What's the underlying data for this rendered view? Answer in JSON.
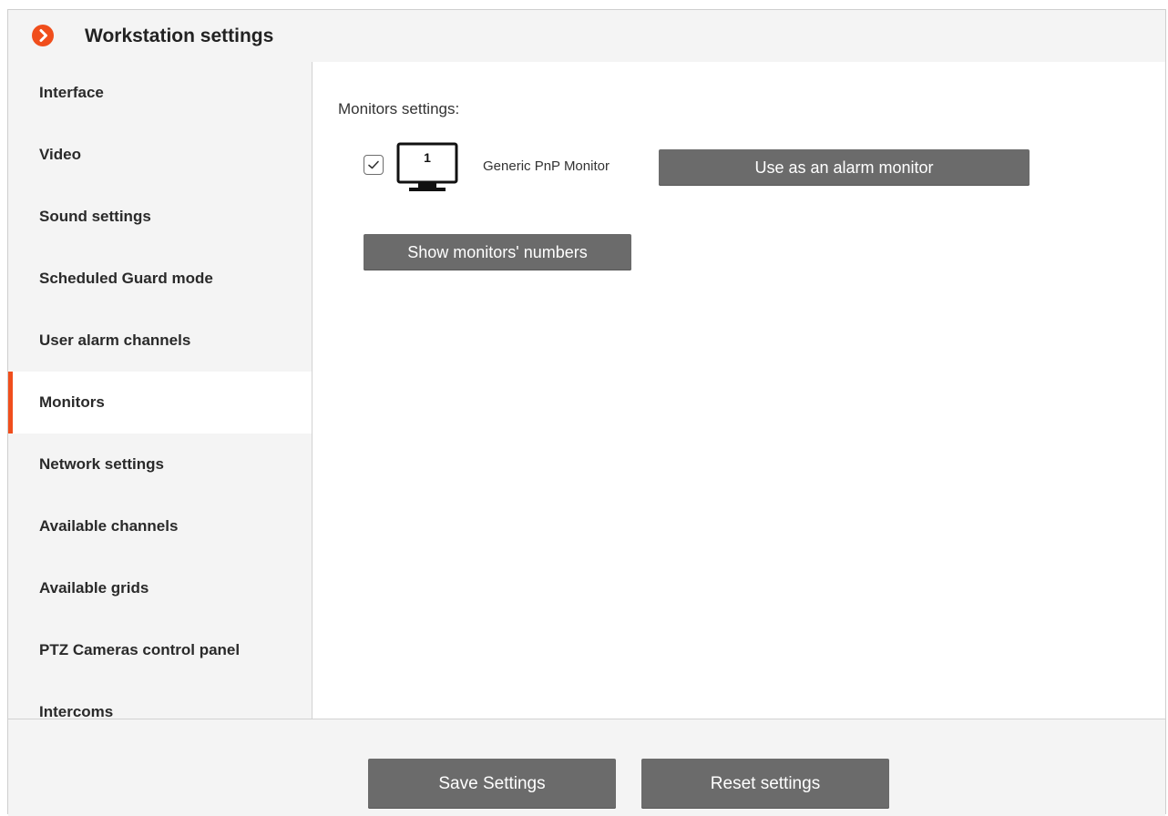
{
  "window": {
    "title": "Workstation settings",
    "title_icon": "orange-chevron-right-icon",
    "accent_color": "#f04e1c"
  },
  "sidebar": {
    "items": [
      {
        "label": "Interface",
        "active": false
      },
      {
        "label": "Video",
        "active": false
      },
      {
        "label": "Sound settings",
        "active": false
      },
      {
        "label": "Scheduled Guard mode",
        "active": false
      },
      {
        "label": "User alarm channels",
        "active": false
      },
      {
        "label": "Monitors",
        "active": true
      },
      {
        "label": "Network settings",
        "active": false
      },
      {
        "label": "Available channels",
        "active": false
      },
      {
        "label": "Available grids",
        "active": false
      },
      {
        "label": "PTZ Cameras control panel",
        "active": false
      },
      {
        "label": "Intercoms",
        "active": false
      }
    ]
  },
  "main": {
    "section_label": "Monitors settings:",
    "monitors": [
      {
        "checked": true,
        "number": "1",
        "name": "Generic PnP Monitor",
        "alarm_button": "Use as an alarm monitor"
      }
    ],
    "show_numbers_button": "Show monitors' numbers"
  },
  "footer": {
    "save_label": "Save Settings",
    "reset_label": "Reset settings"
  }
}
